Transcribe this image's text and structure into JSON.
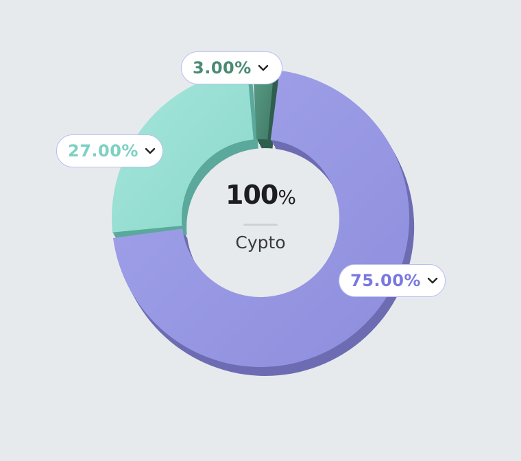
{
  "chart_data": {
    "type": "pie",
    "style": "3d-donut",
    "center_value": "100",
    "center_unit": "%",
    "center_caption": "Cypto",
    "slices": [
      {
        "label": "3.00%",
        "value": 3,
        "color": "#4e8f78",
        "label_color": "#4a8a72"
      },
      {
        "label": "75.00%",
        "value": 75,
        "color": "#9798e2",
        "label_color": "#7a78e0"
      },
      {
        "label": "27.00%",
        "value": 27,
        "color": "#97ded3",
        "label_color": "#7dd1c3"
      }
    ]
  },
  "icons": {
    "dropdown": "chevron-down-icon"
  }
}
